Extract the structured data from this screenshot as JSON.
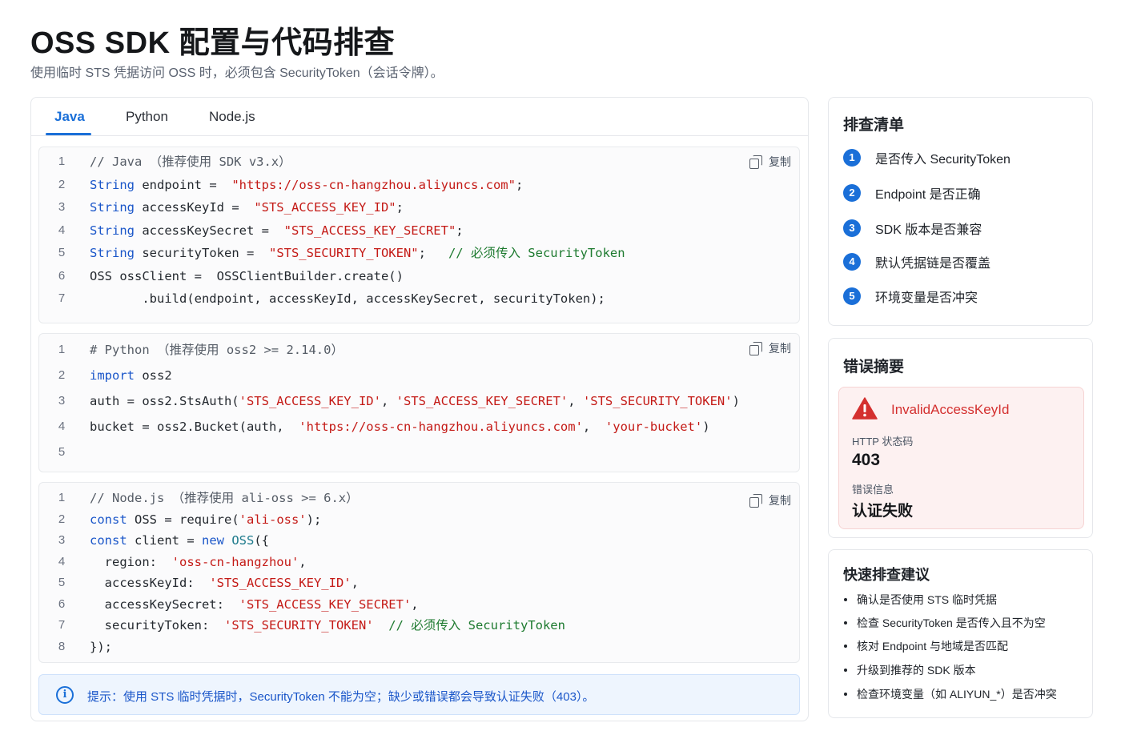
{
  "header": {
    "title": "OSS SDK 配置与代码排查",
    "subtitle": "使用临时 STS 凭据访问 OSS 时，必须包含 SecurityToken（会话令牌）。"
  },
  "tabs": [
    {
      "label": "Java",
      "active": true
    },
    {
      "label": "Python",
      "active": false
    },
    {
      "label": "Node.js",
      "active": false
    }
  ],
  "copy_label": "复制",
  "code_blocks": [
    {
      "language": "Java",
      "lines": [
        {
          "no": "1",
          "segments": [
            {
              "t": "gray",
              "v": "// Java （推荐使用 SDK v3.x）"
            }
          ]
        },
        {
          "no": "2",
          "segments": [
            {
              "t": "kw",
              "v": "String"
            },
            {
              "t": "",
              "v": " endpoint =  "
            },
            {
              "t": "str",
              "v": "\"https://oss-cn-hangzhou.aliyuncs.com\""
            },
            {
              "t": "",
              "v": ";"
            }
          ]
        },
        {
          "no": "3",
          "segments": [
            {
              "t": "kw",
              "v": "String"
            },
            {
              "t": "",
              "v": " accessKeyId =  "
            },
            {
              "t": "str",
              "v": "\"STS_ACCESS_KEY_ID\""
            },
            {
              "t": "",
              "v": ";"
            }
          ]
        },
        {
          "no": "4",
          "segments": [
            {
              "t": "kw",
              "v": "String"
            },
            {
              "t": "",
              "v": " accessKeySecret =  "
            },
            {
              "t": "str",
              "v": "\"STS_ACCESS_KEY_SECRET\""
            },
            {
              "t": "",
              "v": ";"
            }
          ]
        },
        {
          "no": "5",
          "segments": [
            {
              "t": "kw",
              "v": "String"
            },
            {
              "t": "",
              "v": " securityToken =  "
            },
            {
              "t": "str",
              "v": "\"STS_SECURITY_TOKEN\""
            },
            {
              "t": "",
              "v": ";   "
            },
            {
              "t": "cm",
              "v": "// 必须传入 SecurityToken"
            }
          ]
        },
        {
          "no": "6",
          "segments": [
            {
              "t": "",
              "v": "OSS ossClient =  OSSClientBuilder.create()"
            }
          ]
        },
        {
          "no": "7",
          "segments": [
            {
              "t": "",
              "v": "       .build(endpoint, accessKeyId, accessKeySecret, securityToken);"
            }
          ]
        }
      ]
    },
    {
      "language": "Python",
      "lines": [
        {
          "no": "1",
          "segments": [
            {
              "t": "gray",
              "v": "# Python （推荐使用 oss2 >= 2.14.0）"
            }
          ]
        },
        {
          "no": "2",
          "segments": [
            {
              "t": "kw",
              "v": "import"
            },
            {
              "t": "",
              "v": " oss2"
            }
          ]
        },
        {
          "no": "3",
          "segments": [
            {
              "t": "",
              "v": "auth = oss2.StsAuth("
            },
            {
              "t": "str",
              "v": "'STS_ACCESS_KEY_ID'"
            },
            {
              "t": "",
              "v": ", "
            },
            {
              "t": "str",
              "v": "'STS_ACCESS_KEY_SECRET'"
            },
            {
              "t": "",
              "v": ", "
            },
            {
              "t": "str",
              "v": "'STS_SECURITY_TOKEN'"
            },
            {
              "t": "",
              "v": ")"
            }
          ]
        },
        {
          "no": "4",
          "segments": [
            {
              "t": "",
              "v": "bucket = oss2.Bucket(auth,  "
            },
            {
              "t": "str",
              "v": "'https://oss-cn-hangzhou.aliyuncs.com'"
            },
            {
              "t": "",
              "v": ",  "
            },
            {
              "t": "str",
              "v": "'your-bucket'"
            },
            {
              "t": "",
              "v": ")"
            }
          ]
        },
        {
          "no": "5",
          "segments": [
            {
              "t": "",
              "v": ""
            }
          ]
        }
      ]
    },
    {
      "language": "Node.js",
      "lines": [
        {
          "no": "1",
          "segments": [
            {
              "t": "gray",
              "v": "// Node.js （推荐使用 ali-oss >= 6.x）"
            }
          ]
        },
        {
          "no": "2",
          "segments": [
            {
              "t": "kw",
              "v": "const"
            },
            {
              "t": "",
              "v": " OSS = require("
            },
            {
              "t": "str",
              "v": "'ali-oss'"
            },
            {
              "t": "",
              "v": ");"
            }
          ]
        },
        {
          "no": "3",
          "segments": [
            {
              "t": "kw",
              "v": "const"
            },
            {
              "t": "",
              "v": " client = "
            },
            {
              "t": "kw",
              "v": "new"
            },
            {
              "t": "",
              "v": " "
            },
            {
              "t": "kw2",
              "v": "OSS"
            },
            {
              "t": "",
              "v": "({"
            }
          ]
        },
        {
          "no": "4",
          "segments": [
            {
              "t": "",
              "v": "  region:  "
            },
            {
              "t": "str",
              "v": "'oss-cn-hangzhou'"
            },
            {
              "t": "",
              "v": ","
            }
          ]
        },
        {
          "no": "5",
          "segments": [
            {
              "t": "",
              "v": "  accessKeyId:  "
            },
            {
              "t": "str",
              "v": "'STS_ACCESS_KEY_ID'"
            },
            {
              "t": "",
              "v": ","
            }
          ]
        },
        {
          "no": "6",
          "segments": [
            {
              "t": "",
              "v": "  accessKeySecret:  "
            },
            {
              "t": "str",
              "v": "'STS_ACCESS_KEY_SECRET'"
            },
            {
              "t": "",
              "v": ","
            }
          ]
        },
        {
          "no": "7",
          "segments": [
            {
              "t": "",
              "v": "  securityToken:  "
            },
            {
              "t": "str",
              "v": "'STS_SECURITY_TOKEN'"
            },
            {
              "t": "",
              "v": "  "
            },
            {
              "t": "cm",
              "v": "// 必须传入 SecurityToken"
            }
          ]
        },
        {
          "no": "8",
          "segments": [
            {
              "t": "",
              "v": "});"
            }
          ]
        }
      ]
    }
  ],
  "hint": {
    "icon": "info-icon",
    "text": "提示：使用 STS 临时凭据时，SecurityToken 不能为空；缺少或错误都会导致认证失败（403）。"
  },
  "checklist": {
    "title": "排查清单",
    "items": [
      {
        "num": "1",
        "label": "是否传入 SecurityToken"
      },
      {
        "num": "2",
        "label": "Endpoint 是否正确"
      },
      {
        "num": "3",
        "label": "SDK 版本是否兼容"
      },
      {
        "num": "4",
        "label": "默认凭据链是否覆盖"
      },
      {
        "num": "5",
        "label": "环境变量是否冲突"
      }
    ]
  },
  "error_summary": {
    "title": "错误摘要",
    "icon": "warning-icon",
    "error_code": "InvalidAccessKeyId",
    "status_label": "HTTP 状态码",
    "status_value": "403",
    "message_label": "错误信息",
    "message_value": "认证失败"
  },
  "quick_tips": {
    "title": "快速排查建议",
    "items": [
      "确认是否使用 STS 临时凭据",
      "检查 SecurityToken 是否传入且不为空",
      "核对 Endpoint 与地域是否匹配",
      "升级到推荐的 SDK 版本",
      "检查环境变量（如 ALIYUN_*）是否冲突"
    ]
  },
  "colors": {
    "accent": "#1a6fd8",
    "keyword": "#1a56c9",
    "string": "#c41a16",
    "comment": "#1d7a2f",
    "error": "#d4302f"
  }
}
